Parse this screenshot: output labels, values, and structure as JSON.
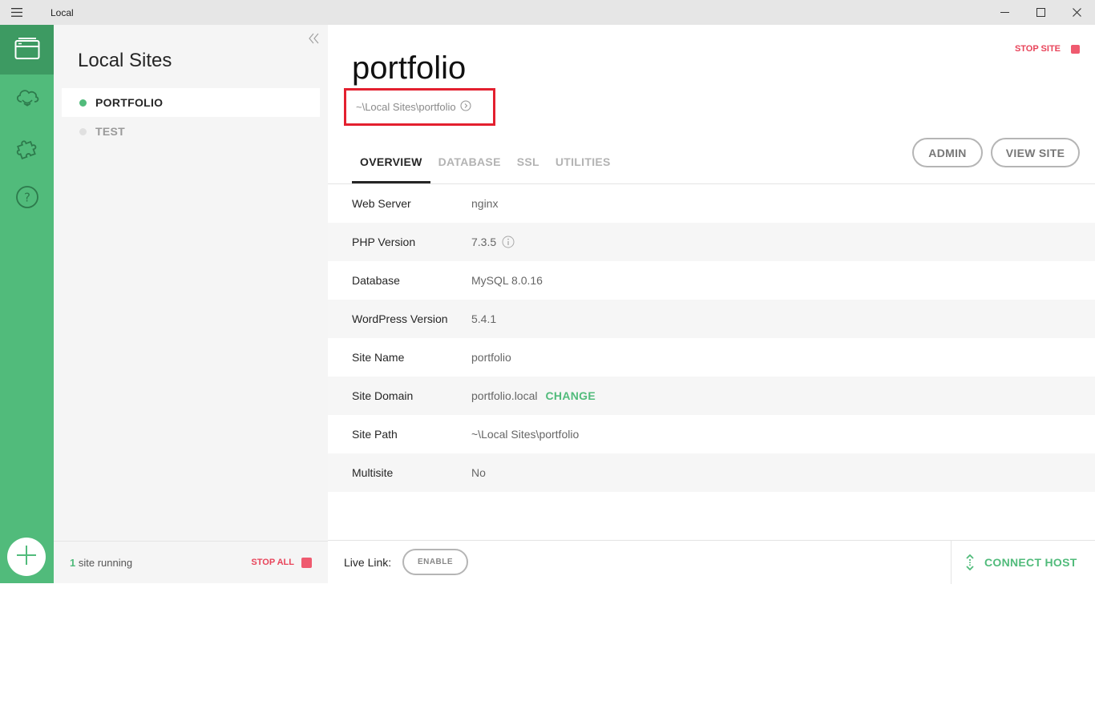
{
  "window": {
    "title": "Local"
  },
  "rail": {
    "items": [
      {
        "icon": "local-sites-icon",
        "active": true
      },
      {
        "icon": "cloud-icon",
        "active": false
      },
      {
        "icon": "addons-puzzle-icon",
        "active": false
      },
      {
        "icon": "help-icon",
        "active": false
      }
    ],
    "add_icon": "plus-icon"
  },
  "sites_panel": {
    "title": "Local Sites",
    "sites": [
      {
        "name": "PORTFOLIO",
        "status": "running",
        "dot_color": "#51bb7b"
      },
      {
        "name": "TEST",
        "status": "stopped",
        "dot_color": "#e0e0e0"
      }
    ],
    "footer": {
      "count": "1",
      "running_text": "site running",
      "stop_all": "STOP ALL"
    }
  },
  "site": {
    "name": "portfolio",
    "path": "~\\Local Sites\\portfolio",
    "stop_site": "STOP SITE",
    "tabs": [
      "OVERVIEW",
      "DATABASE",
      "SSL",
      "UTILITIES"
    ],
    "active_tab": "OVERVIEW",
    "admin_button": "ADMIN",
    "view_site_button": "VIEW SITE",
    "overview": {
      "web_server": {
        "label": "Web Server",
        "value": "nginx"
      },
      "php_version": {
        "label": "PHP Version",
        "value": "7.3.5"
      },
      "database": {
        "label": "Database",
        "value": "MySQL 8.0.16"
      },
      "wordpress_version": {
        "label": "WordPress Version",
        "value": "5.4.1"
      },
      "site_name": {
        "label": "Site Name",
        "value": "portfolio"
      },
      "site_domain": {
        "label": "Site Domain",
        "value": "portfolio.local",
        "action": "CHANGE"
      },
      "site_path": {
        "label": "Site Path",
        "value": "~\\Local Sites\\portfolio"
      },
      "multisite": {
        "label": "Multisite",
        "value": "No"
      }
    },
    "footer": {
      "live_link_label": "Live Link:",
      "enable_button": "ENABLE",
      "connect_host": "CONNECT HOST"
    }
  },
  "colors": {
    "accent": "#51bb7b",
    "accent_dark": "#3d9a62",
    "danger": "#e8445a",
    "highlight_box": "#e3202f"
  }
}
